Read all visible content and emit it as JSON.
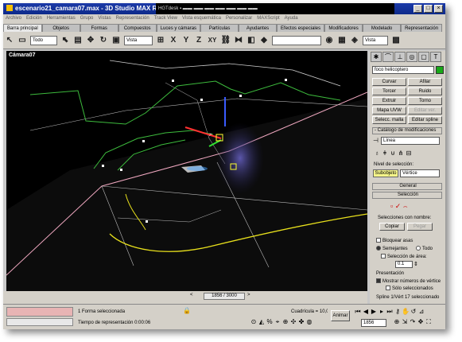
{
  "window": {
    "title": "escenario21_camara07.max - 3D Studio MAX R3",
    "taskbar_text": "HGTdesk ▪ ▬▬ ▬▬ ▬▬ ▬▬ ▬▬ ▬▬ ▬▬",
    "minimize": "_",
    "maximize": "□",
    "close": "×"
  },
  "menu": [
    "Archivo",
    "Edición",
    "Herramientas",
    "Grupo",
    "Vistas",
    "Representación",
    "Track View",
    "Vista esquemática",
    "Personalizar",
    "MAXScript",
    "Ayuda"
  ],
  "tabs": [
    "Barra principal",
    "Objetos",
    "Formas",
    "Compuestos",
    "Luces y cámaras",
    "Partículas",
    "Ayudantes",
    "Efectos especiales",
    "Modificadores",
    "Modelado",
    "Representación"
  ],
  "toolbar": {
    "select_filter": "Todo",
    "view_dropdown": "Vista",
    "axis_x": "X",
    "axis_y": "Y",
    "axis_z": "Z",
    "axis_xy": "XY",
    "view_dropdown_2": "Vista"
  },
  "viewport": {
    "label": "Cámara07"
  },
  "panel": {
    "object_name": "foco helicoptero",
    "buttons": [
      "Curvar",
      "Afilar",
      "Torcer",
      "Ruido",
      "Extruir",
      "Torno",
      "Mapa UVW",
      "Editar ver.",
      "Selecc. malla",
      "Editar spline"
    ],
    "modifier_catalog": "- Catálogo de modificaciones",
    "modifier_value": "Línea",
    "selection_level": "Nivel de selección:",
    "subobject": "Subobjeto",
    "subobject_level": "Vértice",
    "rollout_general": "General",
    "rollout_selection": "Selección",
    "named_selections": "Selecciones con nombre:",
    "copy": "Copiar",
    "paste": "Pegar",
    "lock_handles": "Bloquear asas",
    "similar": "Semejantes",
    "all": "Todo",
    "area_selection": "Selección de área:",
    "area_value": "0.1",
    "display": "Presentación",
    "show_vertex_numbers": "Mostrar números de vértice",
    "only_selected": "Sólo seleccionados",
    "status": "Spline 1/Vért 17 seleccionado"
  },
  "timeline": {
    "frame": "1856 / 3000"
  },
  "status": {
    "selection_info": "1 Forma seleccionada",
    "render_time": "Tiempo de representación  0:00:06",
    "grid": "Cuadrícula = 10,0",
    "animate": "Animar",
    "frame_field": "1856"
  },
  "colors": {
    "title_bg": "#1c3aa8",
    "viewport_bg": "#000000",
    "panel_bg": "#d4d0c8",
    "selected_yellow": "#f5f58a"
  }
}
